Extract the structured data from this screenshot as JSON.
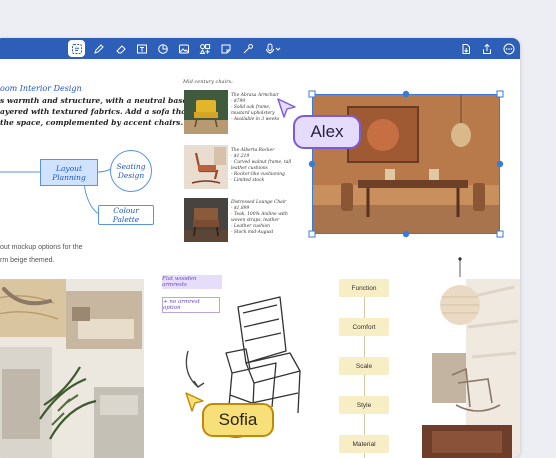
{
  "toolbar": {
    "tools": [
      {
        "name": "lasso-select",
        "active": true
      },
      {
        "name": "pen"
      },
      {
        "name": "eraser"
      },
      {
        "name": "text-box"
      },
      {
        "name": "shapes"
      },
      {
        "name": "image"
      },
      {
        "name": "elements"
      },
      {
        "name": "sticky-note"
      },
      {
        "name": "laser-pointer"
      },
      {
        "name": "voice"
      }
    ],
    "right_tools": [
      "export",
      "share",
      "more"
    ]
  },
  "note": {
    "title": "oom Interior Design",
    "lines": [
      "s warmth and structure, with a neutral base",
      "ayered with textured fabrics. Add a sofa that",
      "the space, complemented by accent chairs."
    ]
  },
  "mindmap": {
    "layout_planning": "Layout Planning",
    "seating_design": "Seating Design",
    "colour_palette": "Colour Palette"
  },
  "mockup_text": [
    "out mockup options for the",
    "rm beige themed."
  ],
  "mid_century": {
    "title": "Mid century chairs:",
    "notes": [
      [
        "The Abraxa Armchair",
        "- $799",
        "- Solid oak frame,",
        "  mustard upholstery",
        "- Available in 3 weeks"
      ],
      [
        "The Alberta Rocker",
        "- $1,219",
        "- Curved walnut frame, tall",
        "  leather cushions",
        "- Rocker-like cushioning",
        "- Limited stock"
      ],
      [
        "Distressed Lounge Chair",
        "- $1,899",
        "- Teak, 100% Aniline with",
        "  woven straps, leather",
        "- Leather cushion",
        "- Stock mid-August"
      ]
    ]
  },
  "stickies": {
    "flat_wooden": "Flat wooden armrests",
    "no_armrest": "+ no armrest option"
  },
  "cursors": {
    "alex": {
      "name": "Alex",
      "color": "#7d5bd6",
      "bg": "#e5dcfb"
    },
    "sofia": {
      "name": "Sofia",
      "color": "#c08a05",
      "bg": "#f7df7a"
    }
  },
  "flowchart": [
    "Function",
    "Comfort",
    "Scale",
    "Style",
    "Material"
  ]
}
